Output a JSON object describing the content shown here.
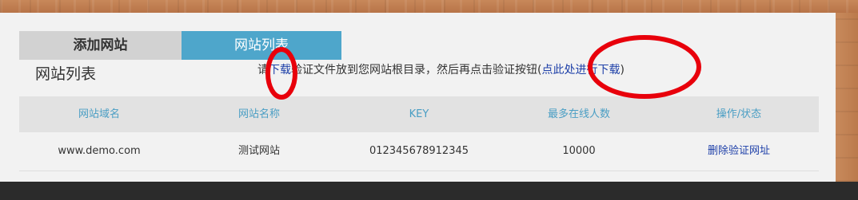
{
  "tabs": {
    "add_site": "添加网站",
    "site_list": "网站列表"
  },
  "section_title": "网站列表",
  "notice": {
    "prefix": "请",
    "download_link": "下载",
    "middle": "验证文件放到您网站根目录，然后再点击验证按钮",
    "open_paren": "(",
    "click_here_link": "点此处进行下载",
    "close_paren": ")"
  },
  "table": {
    "headers": [
      "网站域名",
      "网站名称",
      "KEY",
      "最多在线人数",
      "操作/状态"
    ],
    "rows": [
      {
        "domain": "www.demo.com",
        "name": "测试网站",
        "key": "012345678912345",
        "max_online": "10000",
        "delete_label": "删除",
        "verify_label": "验证网址"
      }
    ]
  },
  "colors": {
    "tab_active": "#4ea6cb",
    "tab_inactive": "#d2d2d2",
    "header_text": "#4a9ec4",
    "link": "#1d3fa8",
    "annotation": "#e8000b"
  }
}
